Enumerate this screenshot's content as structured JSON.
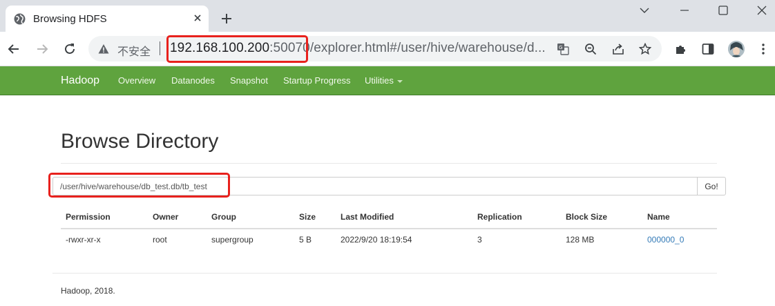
{
  "browser": {
    "tab_title": "Browsing HDFS",
    "security_label": "不安全",
    "url_host": "192.168.100.200",
    "url_port": ":50070",
    "url_path": "/explorer.html#/user/hive/warehouse/d..."
  },
  "nav": {
    "brand": "Hadoop",
    "items": [
      "Overview",
      "Datanodes",
      "Snapshot",
      "Startup Progress",
      "Utilities"
    ]
  },
  "page": {
    "title": "Browse Directory",
    "path_value": "/user/hive/warehouse/db_test.db/tb_test",
    "go_label": "Go!"
  },
  "table": {
    "columns": [
      "Permission",
      "Owner",
      "Group",
      "Size",
      "Last Modified",
      "Replication",
      "Block Size",
      "Name"
    ],
    "rows": [
      [
        "-rwxr-xr-x",
        "root",
        "supergroup",
        "5 B",
        "2022/9/20 18:19:54",
        "3",
        "128 MB",
        "000000_0"
      ]
    ]
  },
  "footer": "Hadoop, 2018.",
  "colors": {
    "navbar": "#5fa33e",
    "link": "#337ab7",
    "highlight": "#e8211d"
  }
}
